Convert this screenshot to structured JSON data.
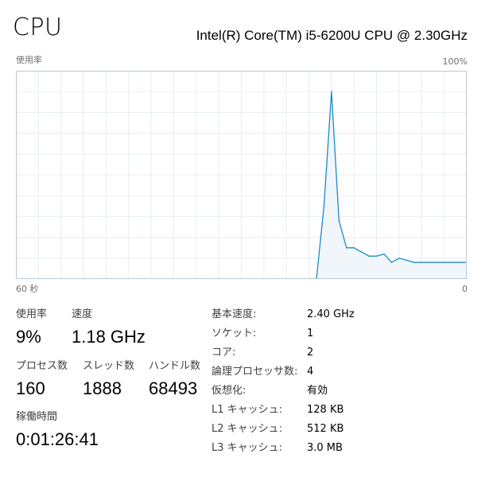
{
  "header": {
    "title": "CPU",
    "model": "Intel(R) Core(TM) i5-6200U CPU @ 2.30GHz"
  },
  "graph": {
    "usage_label": "使用率",
    "max_label": "100%",
    "time_label": "60 秒",
    "zero_label": "0",
    "line_color": "#1b8bc8",
    "fill_color": "#f1f6fb",
    "grid_color": "#e6edf3",
    "border_color": "#b9c9d6"
  },
  "chart_data": {
    "type": "area",
    "x": [
      40,
      41,
      42,
      43,
      44,
      45,
      46,
      47,
      48,
      49,
      50,
      51,
      52,
      53,
      54,
      55,
      56,
      57,
      58,
      59,
      60
    ],
    "values": [
      0,
      35,
      90,
      28,
      15,
      15,
      13,
      11,
      11,
      12,
      8,
      10,
      9,
      8,
      8,
      8,
      8,
      8,
      8,
      8,
      8
    ],
    "xlim": [
      0,
      60
    ],
    "ylim": [
      0,
      100
    ],
    "grid": true,
    "title": "",
    "xlabel": "",
    "ylabel": ""
  },
  "stats": {
    "usage_label": "使用率",
    "usage_value": "9%",
    "speed_label": "速度",
    "speed_value": "1.18 GHz",
    "processes_label": "プロセス数",
    "processes_value": "160",
    "threads_label": "スレッド数",
    "threads_value": "1888",
    "handles_label": "ハンドル数",
    "handles_value": "68493",
    "uptime_label": "稼働時間",
    "uptime_value": "0:01:26:41"
  },
  "info": [
    {
      "key": "基本速度:",
      "value": "2.40 GHz"
    },
    {
      "key": "ソケット:",
      "value": "1"
    },
    {
      "key": "コア:",
      "value": "2"
    },
    {
      "key": "論理プロセッサ数:",
      "value": "4"
    },
    {
      "key": "仮想化:",
      "value": "有効"
    },
    {
      "key": "L1 キャッシュ:",
      "value": "128 KB"
    },
    {
      "key": "L2 キャッシュ:",
      "value": "512 KB"
    },
    {
      "key": "L3 キャッシュ:",
      "value": "3.0 MB"
    }
  ]
}
